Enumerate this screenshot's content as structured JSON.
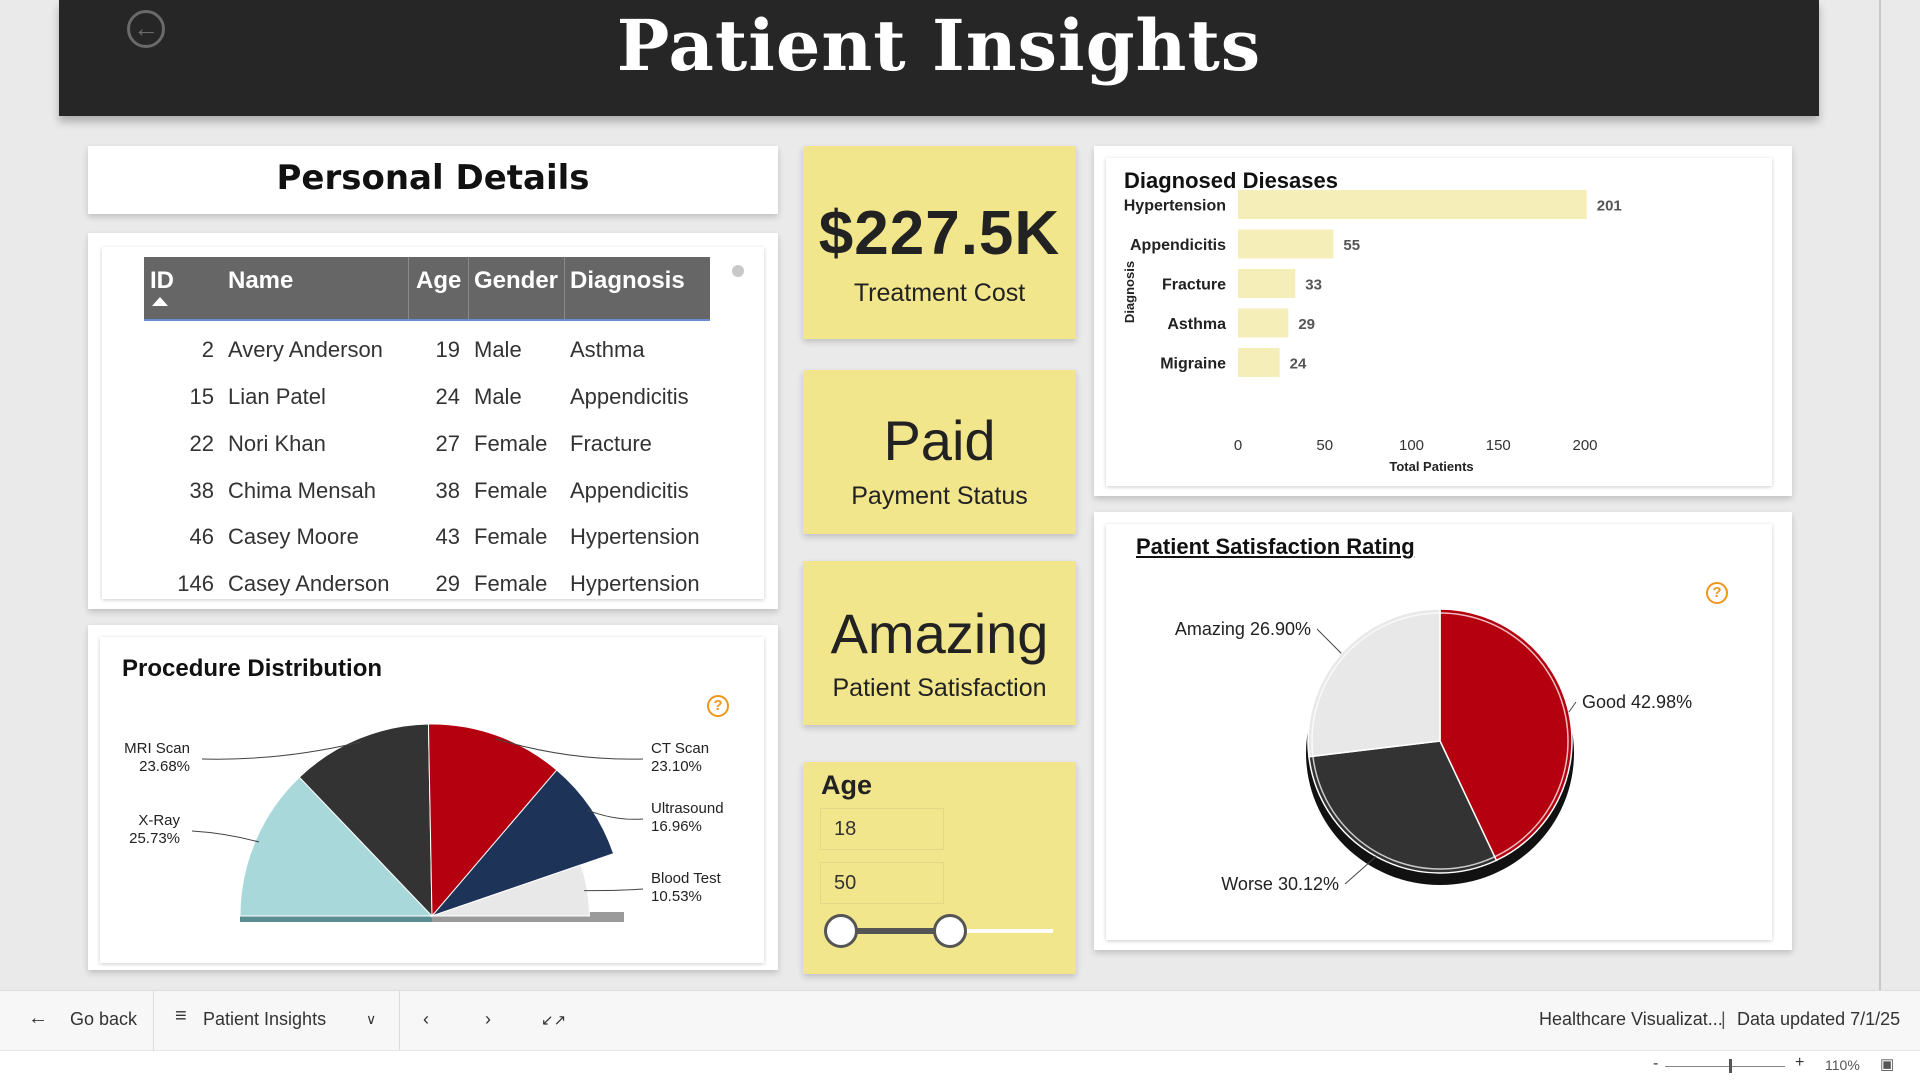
{
  "report": {
    "title": "Patient Insights"
  },
  "personal_details": {
    "title": "Personal Details",
    "columns": [
      "ID",
      "Name",
      "Age",
      "Gender",
      "Diagnosis"
    ],
    "rows": [
      {
        "id": "2",
        "name": "Avery Anderson",
        "age": "19",
        "gender": "Male",
        "diagnosis": "Asthma"
      },
      {
        "id": "15",
        "name": "Lian Patel",
        "age": "24",
        "gender": "Male",
        "diagnosis": "Appendicitis"
      },
      {
        "id": "22",
        "name": "Nori Khan",
        "age": "27",
        "gender": "Female",
        "diagnosis": "Fracture"
      },
      {
        "id": "38",
        "name": "Chima Mensah",
        "age": "38",
        "gender": "Female",
        "diagnosis": "Appendicitis"
      },
      {
        "id": "46",
        "name": "Casey Moore",
        "age": "43",
        "gender": "Female",
        "diagnosis": "Hypertension"
      },
      {
        "id": "146",
        "name": "Casey Anderson",
        "age": "29",
        "gender": "Female",
        "diagnosis": "Hypertension"
      }
    ]
  },
  "kpis": {
    "treatment_cost": {
      "value": "$227.5K",
      "label": "Treatment Cost"
    },
    "payment_status": {
      "value": "Paid",
      "label": "Payment Status"
    },
    "satisfaction": {
      "value": "Amazing",
      "label": "Patient Satisfaction"
    }
  },
  "age_filter": {
    "title": "Age",
    "min": "18",
    "max": "50"
  },
  "footer": {
    "go_back": "Go back",
    "page_name": "Patient Insights",
    "report_name": "Healthcare Visualizat...",
    "data_updated": "Data updated 7/1/25",
    "zoom": "110%"
  },
  "colors": {
    "banner": "#262626",
    "kpi_yellow": "#f2e68c",
    "bar_fill": "#f5eeb8",
    "accent_red": "#b5000f",
    "dark": "#333333",
    "light_gray": "#e8e8e8",
    "teal": "#a8d8da",
    "navy": "#1d3358",
    "help_orange": "#f0961b"
  },
  "chart_data": [
    {
      "id": "diagnosed-diseases",
      "type": "bar",
      "orientation": "horizontal",
      "title": "Diagnosed Diesases",
      "ylabel": "Diagnosis",
      "xlabel": "Total Patients",
      "categories": [
        "Hypertension",
        "Appendicitis",
        "Fracture",
        "Asthma",
        "Migraine"
      ],
      "values": [
        201,
        55,
        33,
        29,
        24
      ],
      "xlim": [
        0,
        200
      ],
      "xticks": [
        0,
        50,
        100,
        150,
        200
      ],
      "grid": false
    },
    {
      "id": "procedure-distribution",
      "type": "pie",
      "variant": "half-pie",
      "title": "Procedure Distribution",
      "slices": [
        {
          "label": "X-Ray",
          "value_text": "25.73%",
          "value": 25.73
        },
        {
          "label": "MRI Scan",
          "value_text": "23.68%",
          "value": 23.68
        },
        {
          "label": "CT Scan",
          "value_text": "23.10%",
          "value": 23.1
        },
        {
          "label": "Ultrasound",
          "value_text": "16.96%",
          "value": 16.96
        },
        {
          "label": "Blood Test",
          "value_text": "10.53%",
          "value": 10.53
        }
      ]
    },
    {
      "id": "patient-satisfaction",
      "type": "pie",
      "title": "Patient Satisfaction Rating",
      "slices": [
        {
          "label": "Good",
          "value_text": "42.98%",
          "value": 42.98
        },
        {
          "label": "Worse",
          "value_text": "30.12%",
          "value": 30.12
        },
        {
          "label": "Amazing",
          "value_text": "26.90%",
          "value": 26.9
        }
      ]
    }
  ]
}
